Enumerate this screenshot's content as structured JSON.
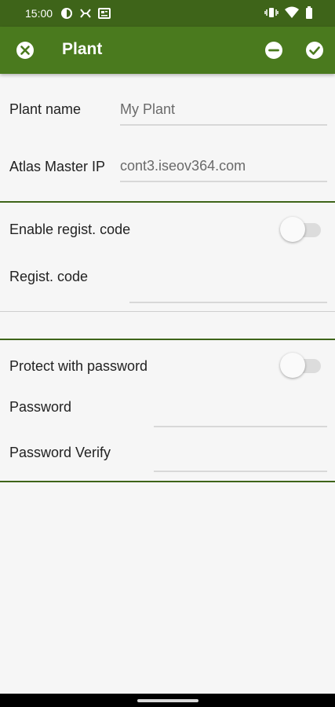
{
  "status_bar": {
    "time": "15:00",
    "left_icons": [
      "app-notification-icon",
      "network-activity-icon",
      "news-icon"
    ],
    "right_icons": [
      "vibrate-icon",
      "wifi-icon",
      "battery-icon"
    ]
  },
  "app_bar": {
    "title": "Plant",
    "background": "#4a7a1e"
  },
  "plant_section": {
    "plant_name_label": "Plant name",
    "plant_name_value": "My Plant",
    "master_ip_label": "Atlas Master IP",
    "master_ip_value": "cont3.iseov364.com"
  },
  "regist_section": {
    "enable_label": "Enable regist. code",
    "enable_on": false,
    "code_label": "Regist. code",
    "code_value": ""
  },
  "password_section": {
    "protect_label": "Protect with password",
    "protect_on": false,
    "password_label": "Password",
    "password_value": "",
    "verify_label": "Password Verify",
    "verify_value": ""
  }
}
